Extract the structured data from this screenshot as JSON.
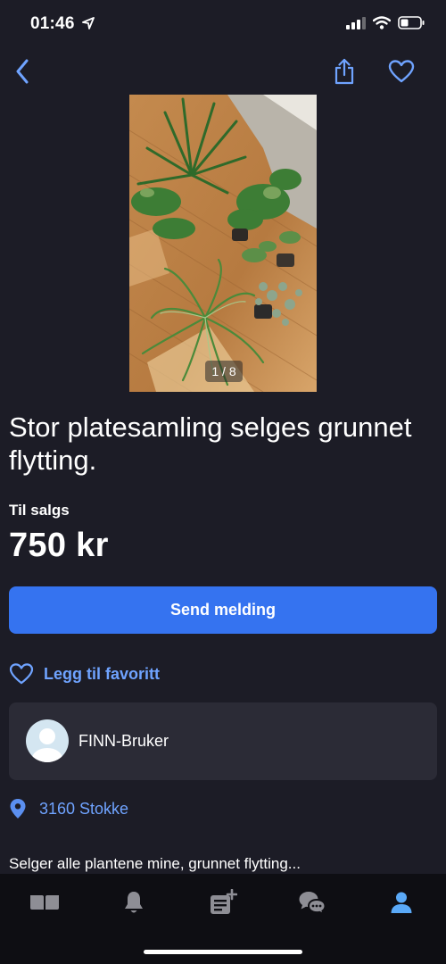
{
  "status_bar": {
    "time": "01:46"
  },
  "ad": {
    "image_counter": "1 / 8",
    "title": "Stor platesamling selges grunnet flytting.",
    "type": "Til salgs",
    "price": "750 kr",
    "description": "Selger alle plantene mine, grunnet flytting..."
  },
  "actions": {
    "send_message": "Send melding",
    "add_favorite": "Legg til favoritt"
  },
  "seller": {
    "name": "FINN-Bruker"
  },
  "location": {
    "text": "3160 Stokke"
  },
  "tab_bar": {
    "tabs": [
      {
        "icon": "marketplace-icon",
        "active": false
      },
      {
        "icon": "notifications-icon",
        "active": false
      },
      {
        "icon": "new-ad-icon",
        "active": false
      },
      {
        "icon": "messages-icon",
        "active": false
      },
      {
        "icon": "profile-icon",
        "active": true
      }
    ]
  },
  "colors": {
    "background": "#1c1c26",
    "accent": "#3573f0",
    "link": "#6fa3ff",
    "card": "#2b2b36",
    "tab_bar": "#0e0e13",
    "tab_inactive": "#8e8e95",
    "tab_active": "#5aa9f7"
  }
}
